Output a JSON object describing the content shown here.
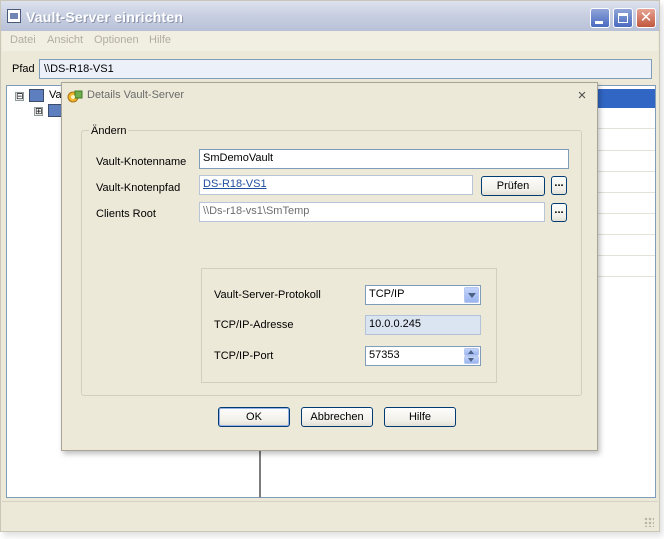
{
  "main_window": {
    "title": "Vault-Server einrichten",
    "menu": [
      "Datei",
      "Ansicht",
      "Optionen",
      "Hilfe"
    ],
    "path_label": "Pfad",
    "path_value": "\\\\DS-R18-VS1",
    "tree": {
      "root_label": "Va",
      "root_expander": "⊟",
      "child_expander": "⊞"
    },
    "window_controls": [
      "minimize-icon",
      "maximize-icon",
      "close-icon"
    ]
  },
  "dialog": {
    "title": "Details Vault-Server",
    "close_glyph": "×",
    "group_label": "Ändern",
    "fields": {
      "node_name_label": "Vault-Knotenname",
      "node_name_value": "SmDemoVault",
      "node_path_label": "Vault-Knotenpfad",
      "node_path_value": "DS-R18-VS1",
      "check_button": "Prüfen",
      "browse_button": "...",
      "clients_root_label": "Clients Root",
      "clients_root_value": "\\\\Ds-r18-vs1\\SmTemp"
    },
    "protocol": {
      "protocol_label": "Vault-Server-Protokoll",
      "protocol_value": "TCP/IP",
      "ip_label": "TCP/IP-Adresse",
      "ip_value": "10.0.0.245",
      "port_label": "TCP/IP-Port",
      "port_value": "57353"
    },
    "buttons": {
      "ok": "OK",
      "cancel": "Abbrechen",
      "help": "Hilfe"
    }
  },
  "colors": {
    "dialog_bg": "#ece9d8",
    "accent": "#3166c4",
    "link": "#1f4fa0"
  }
}
